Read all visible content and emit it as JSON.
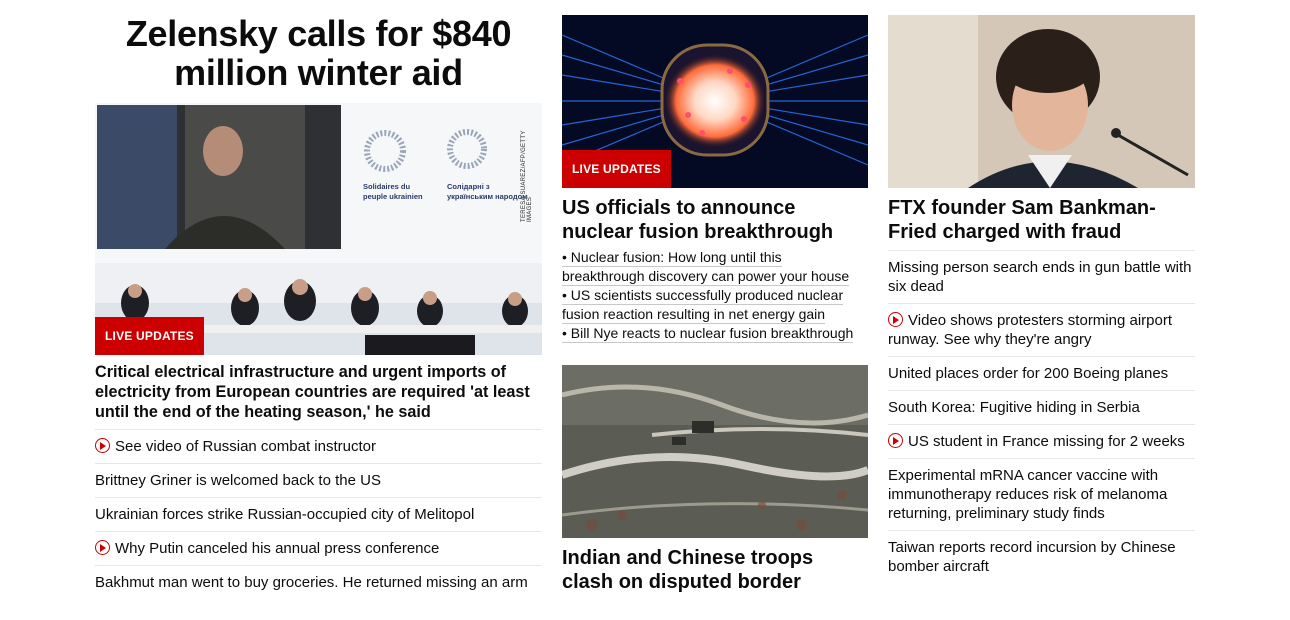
{
  "left": {
    "headline": "Zelensky calls for $840 million winter aid",
    "badge": "LIVE UPDATES",
    "photo_credit": "TERESA SUAREZ/AFP/GETTY IMAGES",
    "screen_logo_1": "Solidaires du peuple ukrainien",
    "screen_logo_2": "Солідарні з українським народом",
    "story_title": "Critical electrical infrastructure and urgent imports of electricity from European countries are required 'at least until the end of the heating season,' he said",
    "links": [
      {
        "text": "See video of Russian combat instructor",
        "video": true
      },
      {
        "text": "Brittney Griner is welcomed back to the US",
        "video": false
      },
      {
        "text": "Ukrainian forces strike Russian-occupied city of Melitopol",
        "video": false
      },
      {
        "text": "Why Putin canceled his annual press conference",
        "video": true
      },
      {
        "text": "Bakhmut man went to buy groceries. He returned missing an arm",
        "video": false
      }
    ]
  },
  "middle": {
    "badge": "LIVE UPDATES",
    "story1_title": "US officials to announce nuclear fusion breakthrough",
    "bullets": [
      "• Nuclear fusion: How long until this breakthrough discovery can power your house",
      "• US scientists successfully produced nuclear fusion reaction resulting in net energy gain",
      "• Bill Nye reacts to nuclear fusion breakthrough"
    ],
    "story2_title": "Indian and Chinese troops clash on disputed border"
  },
  "right": {
    "story_title": "FTX founder Sam Bankman-Fried charged with fraud",
    "links": [
      {
        "text": "Missing person search ends in gun battle with six dead",
        "video": false
      },
      {
        "text": "Video shows protesters storming airport runway. See why they're angry",
        "video": true
      },
      {
        "text": "United places order for 200 Boeing planes",
        "video": false
      },
      {
        "text": "South Korea: Fugitive hiding in Serbia",
        "video": false
      },
      {
        "text": "US student in France missing for 2 weeks",
        "video": true
      },
      {
        "text": "Experimental mRNA cancer vaccine with immunotherapy reduces risk of melanoma returning, preliminary study finds",
        "video": false
      },
      {
        "text": "Taiwan reports record incursion by Chinese bomber aircraft",
        "video": false
      }
    ]
  },
  "colors": {
    "accent": "#cc0000",
    "text": "#0c0c0c",
    "divider": "#e6e6e6"
  }
}
